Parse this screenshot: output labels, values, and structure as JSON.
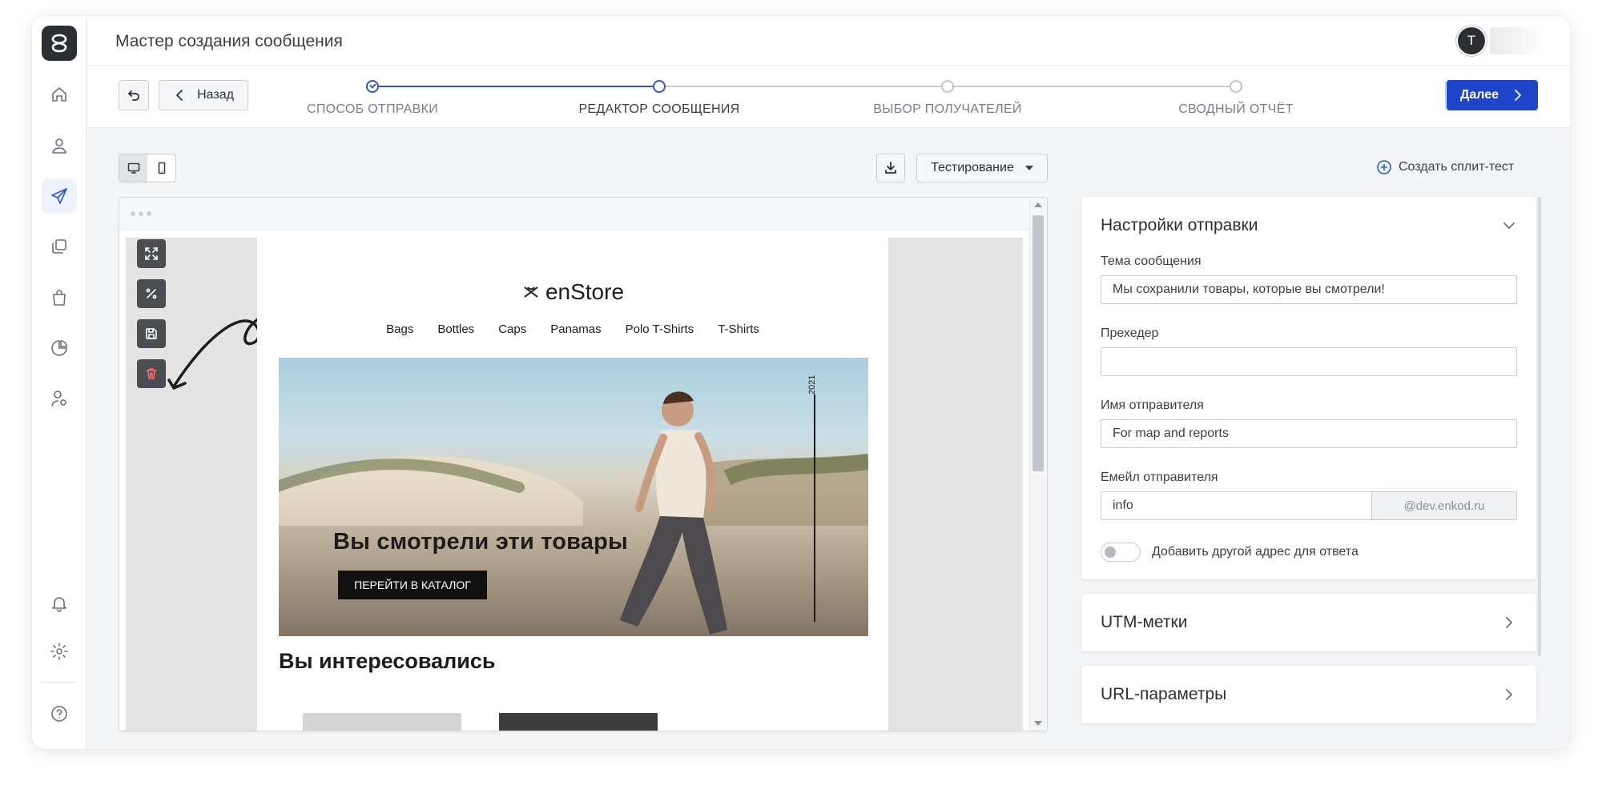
{
  "app": {
    "title": "Мастер создания сообщения",
    "user_initial": "T"
  },
  "wizard": {
    "back_label": "Назад",
    "next_label": "Далее",
    "steps": [
      {
        "label": "СПОСОБ ОТПРАВКИ",
        "state": "done"
      },
      {
        "label": "РЕДАКТОР СООБЩЕНИЯ",
        "state": "current"
      },
      {
        "label": "ВЫБОР ПОЛУЧАТЕЛЕЙ",
        "state": "upcoming"
      },
      {
        "label": "СВОДНЫЙ ОТЧЁТ",
        "state": "upcoming"
      }
    ]
  },
  "toolbar": {
    "testing_label": "Тестирование",
    "split_test_label": "Создать сплит-тест"
  },
  "email": {
    "brand": "enStore",
    "menu": [
      "Bags",
      "Bottles",
      "Caps",
      "Panamas",
      "Polo T-Shirts",
      "T-Shirts"
    ],
    "hero_year": "2021",
    "hero_title": "Вы смотрели эти товары",
    "hero_cta": "ПЕРЕЙТИ В КАТАЛОГ",
    "section_title": "Вы интересовались"
  },
  "settings": {
    "title": "Настройки отправки",
    "subject_label": "Тема сообщения",
    "subject_value": "Мы сохранили товары, которые вы смотрели!",
    "preheader_label": "Прехедер",
    "preheader_value": "",
    "sender_name_label": "Имя отправителя",
    "sender_name_value": "For map and reports",
    "sender_email_label": "Емейл отправителя",
    "sender_email_value": "info",
    "sender_email_domain": "@dev.enkod.ru",
    "reply_toggle_label": "Добавить другой адрес для ответа",
    "reply_toggle_on": false
  },
  "panels": {
    "utm_title": "UTM-метки",
    "url_title": "URL-параметры"
  },
  "colors": {
    "accent": "#1e45c9",
    "sidebar_dark": "#2b2e33",
    "delete_icon": "#ff6b6b"
  }
}
